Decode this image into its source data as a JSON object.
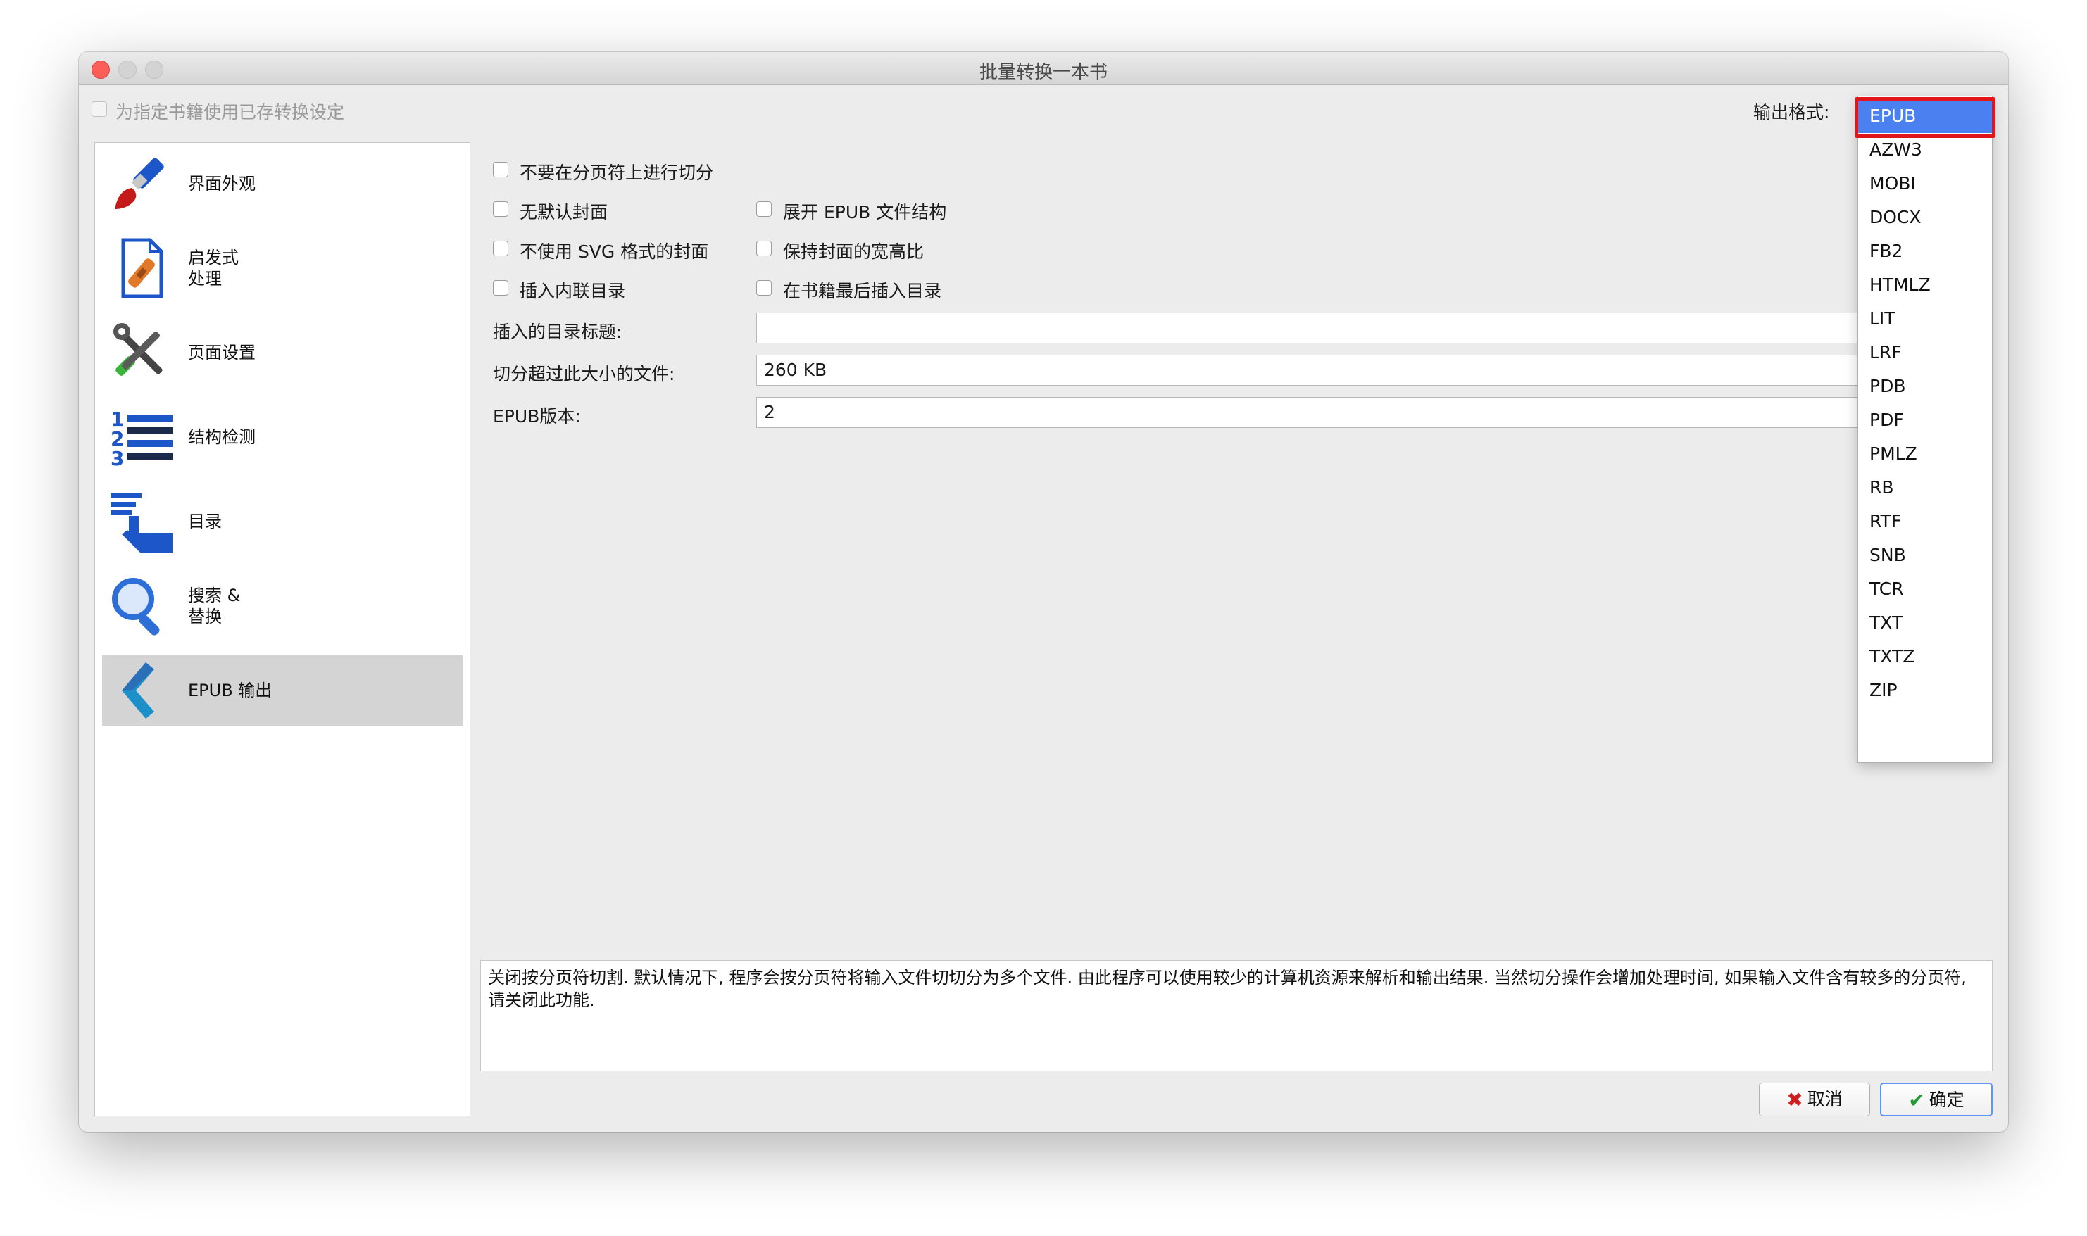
{
  "window": {
    "title": "批量转换一本书"
  },
  "top": {
    "use_saved_label": "为指定书籍使用已存转换设定",
    "output_format_label": "输出格式:"
  },
  "sidebar": {
    "items": [
      {
        "label": "界面外观",
        "icon": "paintbrush-icon"
      },
      {
        "label": "启发式\n处理",
        "icon": "document-bandage-icon"
      },
      {
        "label": "页面设置",
        "icon": "tools-icon"
      },
      {
        "label": "结构检测",
        "icon": "numbered-list-icon"
      },
      {
        "label": "目录",
        "icon": "toc-hand-icon"
      },
      {
        "label": "搜索 &\n替换",
        "icon": "magnifier-icon"
      },
      {
        "label": "EPUB 输出",
        "icon": "back-arrow-icon"
      }
    ],
    "selected": "EPUB 输出"
  },
  "options": {
    "dont_split": "不要在分页符上进行切分",
    "no_default_cover": "无默认封面",
    "flatten_epub": "展开 EPUB 文件结构",
    "no_svg_cover": "不使用 SVG 格式的封面",
    "preserve_aspect": "保持封面的宽高比",
    "insert_inline_toc": "插入内联目录",
    "toc_at_end": "在书籍最后插入目录",
    "toc_title_label": "插入的目录标题:",
    "toc_title_value": "",
    "split_size_label": "切分超过此大小的文件:",
    "split_size_value": "260 KB",
    "epub_version_label": "EPUB版本:",
    "epub_version_value": "2"
  },
  "dropdown": {
    "selected": "EPUB",
    "options": [
      "EPUB",
      "AZW3",
      "MOBI",
      "DOCX",
      "FB2",
      "HTMLZ",
      "LIT",
      "LRF",
      "PDB",
      "PDF",
      "PMLZ",
      "RB",
      "RTF",
      "SNB",
      "TCR",
      "TXT",
      "TXTZ",
      "ZIP"
    ],
    "highlight_color": "#e0161b",
    "selected_color": "#4a80f0"
  },
  "description": "关闭按分页符切割. 默认情况下, 程序会按分页符将输入文件切切分为多个文件. 由此程序可以使用较少的计算机资源来解析和输出结果. 当然切分操作会增加处理时间, 如果输入文件含有较多的分页符, 请关闭此功能.",
  "buttons": {
    "cancel": "取消",
    "ok": "确定"
  }
}
